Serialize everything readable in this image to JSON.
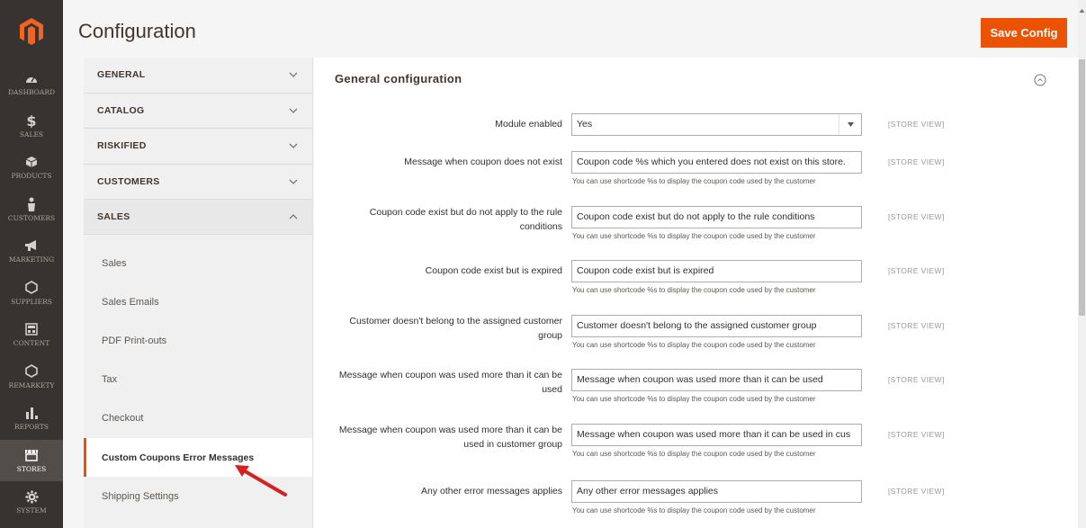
{
  "admin_nav": {
    "items": [
      {
        "label": "Dashboard",
        "icon": "dashboard-icon"
      },
      {
        "label": "Sales",
        "icon": "dollar-icon"
      },
      {
        "label": "Products",
        "icon": "cube-icon"
      },
      {
        "label": "Customers",
        "icon": "person-icon"
      },
      {
        "label": "Marketing",
        "icon": "megaphone-icon"
      },
      {
        "label": "Suppliers",
        "icon": "hexagon-icon"
      },
      {
        "label": "Content",
        "icon": "layout-icon"
      },
      {
        "label": "Remarkety",
        "icon": "hexagon-icon"
      },
      {
        "label": "Reports",
        "icon": "bar-chart-icon"
      },
      {
        "label": "Stores",
        "icon": "store-icon"
      },
      {
        "label": "System",
        "icon": "gear-icon"
      }
    ],
    "active": "Stores"
  },
  "header": {
    "title": "Configuration",
    "save_label": "Save Config"
  },
  "tabs": {
    "sections": [
      {
        "name": "GENERAL",
        "open": false
      },
      {
        "name": "CATALOG",
        "open": false
      },
      {
        "name": "RISKIFIED",
        "open": false
      },
      {
        "name": "CUSTOMERS",
        "open": false
      },
      {
        "name": "SALES",
        "open": true
      }
    ],
    "sales_items": [
      "Sales",
      "Sales Emails",
      "PDF Print-outs",
      "Tax",
      "Checkout",
      "Custom Coupons Error Messages",
      "Shipping Settings"
    ],
    "active_item": "Custom Coupons Error Messages"
  },
  "main": {
    "section_title": "General configuration",
    "scope_label": "[STORE VIEW]",
    "note": "You can use shortcode %s to display the coupon code used by the customer",
    "fields": [
      {
        "label": "Module enabled",
        "value": "Yes",
        "type": "select"
      },
      {
        "label": "Message when coupon does not exist",
        "value": "Coupon code %s which you entered does not exist on this store.",
        "type": "text"
      },
      {
        "label": "Coupon code exist but do not apply to the rule conditions",
        "value": "Coupon code exist but do not apply to the rule conditions",
        "type": "text"
      },
      {
        "label": "Coupon code exist but is expired",
        "value": "Coupon code exist but is expired",
        "type": "text"
      },
      {
        "label": "Customer doesn't belong to the assigned customer group",
        "value": "Customer doesn't belong to the assigned customer group",
        "type": "text"
      },
      {
        "label": "Message when coupon was used more than it can be used",
        "value": "Message when coupon was used more than it can be used",
        "type": "text"
      },
      {
        "label": "Message when coupon was used more than it can be used in customer group",
        "value": "Message when coupon was used more than it can be used in cus",
        "type": "text"
      },
      {
        "label": "Any other error messages applies",
        "value": "Any other error messages applies",
        "type": "text"
      }
    ]
  },
  "colors": {
    "accent": "#eb5202",
    "nav_bg": "#373330",
    "annotation": "#d81e1e"
  }
}
